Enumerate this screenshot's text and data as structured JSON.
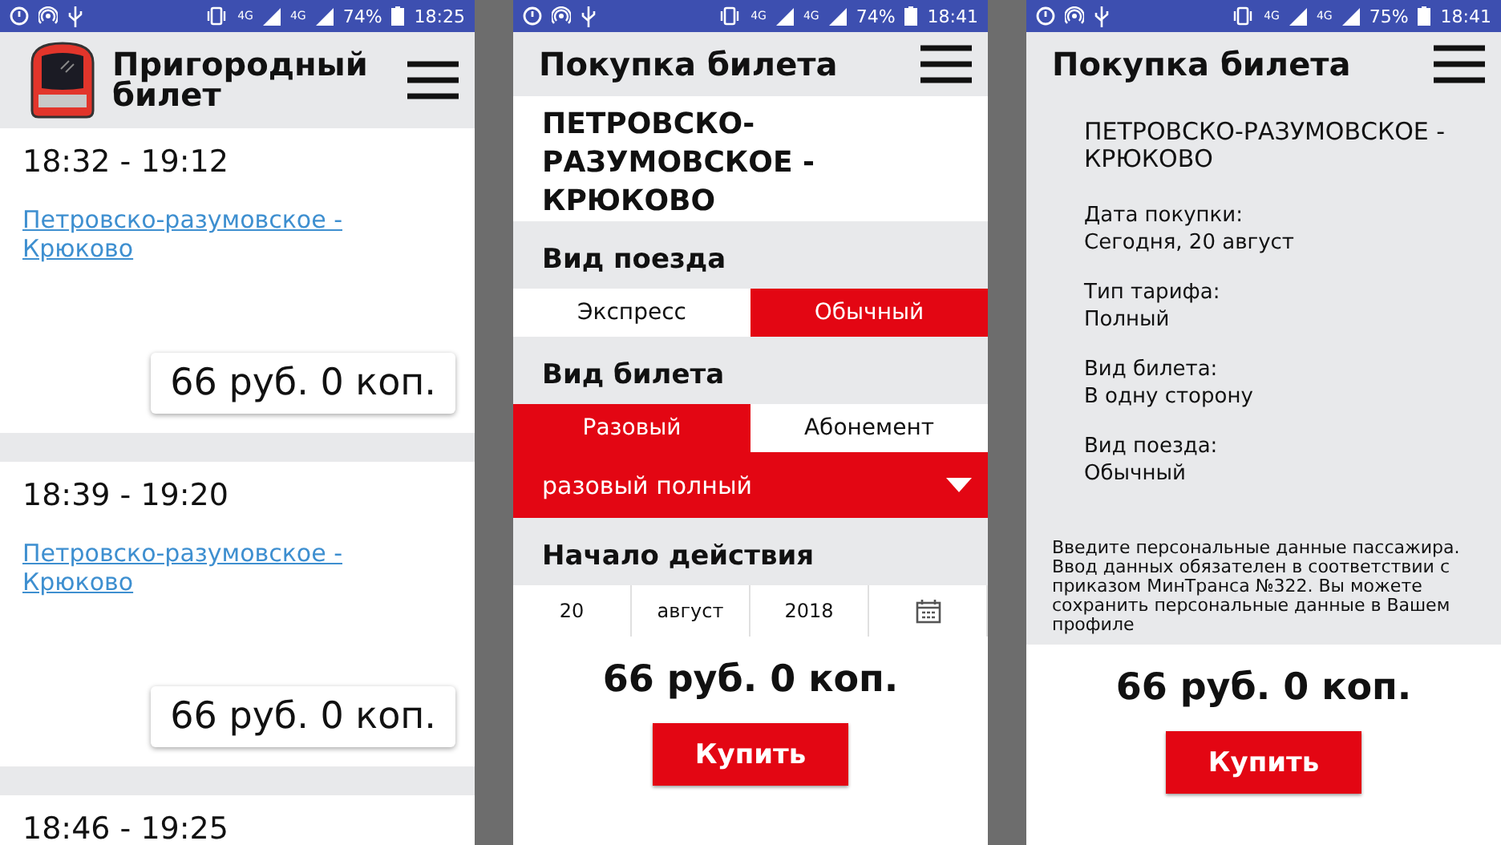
{
  "screens": [
    {
      "kind": "list",
      "status": {
        "networks": [
          "4G",
          "4G"
        ],
        "battery": "74%",
        "time": "18:25"
      },
      "title": "Пригородный билет",
      "trips": [
        {
          "times": "18:32 - 19:12",
          "route": "Петровско-разумовское - Крюково",
          "price": "66 руб. 0 коп."
        },
        {
          "times": "18:39 - 19:20",
          "route": "Петровско-разумовское - Крюково",
          "price": "66 руб. 0 коп."
        },
        {
          "times": "18:46 - 19:25"
        }
      ]
    },
    {
      "kind": "purchase",
      "status": {
        "networks": [
          "4G",
          "4G"
        ],
        "battery": "74%",
        "time": "18:41"
      },
      "title": "Покупка билета",
      "route": "ПЕТРОВСКО-РАЗУМОВСКОЕ - КРЮКОВО",
      "sections": [
        {
          "kind": "toggle",
          "label": "Вид поезда",
          "options": [
            {
              "label": "Экспресс",
              "selected": false
            },
            {
              "label": "Обычный",
              "selected": true
            }
          ]
        },
        {
          "kind": "toggle",
          "label": "Вид билета",
          "options": [
            {
              "label": "Разовый",
              "selected": true
            },
            {
              "label": "Абонемент",
              "selected": false
            }
          ],
          "dropdown": "разовый полный"
        },
        {
          "kind": "date",
          "label": "Начало действия",
          "fields": [
            "20",
            "август",
            "2018"
          ]
        }
      ],
      "price": "66 руб. 0 коп.",
      "button": "Купить"
    },
    {
      "kind": "summary",
      "status": {
        "networks": [
          "4G",
          "4G"
        ],
        "battery": "75%",
        "time": "18:41"
      },
      "title": "Покупка билета",
      "route": "ПЕТРОВСКО-РАЗУМОВСКОЕ - КРЮКОВО",
      "details": [
        {
          "label": "Дата покупки:",
          "value": "Сегодня, 20 август"
        },
        {
          "label": "Тип тарифа:",
          "value": "Полный"
        },
        {
          "label": "Вид билета:",
          "value": "В одну сторону"
        },
        {
          "label": "Вид поезда:",
          "value": "Обычный"
        }
      ],
      "notice": "Введите персональные данные пассажира. Ввод данных обязателен в соответствии с приказом МинТранса №322. Вы можете сохранить персональные данные в Вашем профиле",
      "price": "66 руб. 0 коп.",
      "button": "Купить"
    }
  ]
}
